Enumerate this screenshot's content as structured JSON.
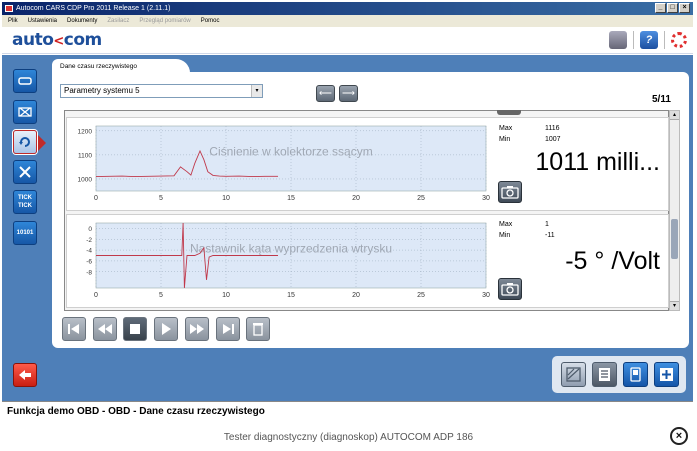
{
  "window": {
    "title": "Autocom CARS CDP Pro   2011 Release 1 (2.11.1)",
    "controls": [
      "_",
      "□",
      "×"
    ]
  },
  "menu": {
    "items": [
      {
        "label": "Plik",
        "enabled": true
      },
      {
        "label": "Ustawienia",
        "enabled": true
      },
      {
        "label": "Dokumenty",
        "enabled": true
      },
      {
        "label": "Zasilacz",
        "enabled": false
      },
      {
        "label": "Przegląd pomiarów",
        "enabled": false
      },
      {
        "label": "Pomoc",
        "enabled": true
      }
    ]
  },
  "header": {
    "logo_left": "auto",
    "logo_sep": "<",
    "logo_right": "com"
  },
  "tab": {
    "label": "Dane czasu rzeczywistego"
  },
  "system_select": {
    "value": "Parametry systemu 5"
  },
  "page_indicator": "5/11",
  "charts": [
    {
      "title": "Ciśnienie w kolektorze ssącym",
      "max_label": "Max",
      "max_value": "1116",
      "min_label": "Min",
      "min_value": "1007",
      "current": "1011 milli...",
      "yticks": [
        "1200",
        "1100",
        "1000"
      ],
      "xticks": [
        "0",
        "5",
        "10",
        "15",
        "20",
        "25",
        "30"
      ]
    },
    {
      "title": "Nastawnik kąta wyprzedzenia wtrysku",
      "max_label": "Max",
      "max_value": "1",
      "min_label": "Min",
      "min_value": "-11",
      "current": "-5 ° /Volt",
      "yticks": [
        "0",
        "-2",
        "-4",
        "-6",
        "-8"
      ],
      "xticks": [
        "0",
        "5",
        "10",
        "15",
        "20",
        "25",
        "30"
      ]
    }
  ],
  "chart_data": [
    {
      "type": "line",
      "title": "Ciśnienie w kolektorze ssącym",
      "xlim": [
        0,
        30
      ],
      "ylim": [
        950,
        1220
      ],
      "x": [
        0,
        1,
        2,
        3,
        4,
        5,
        6,
        6.5,
        7,
        7.3,
        7.6,
        8,
        8.3,
        8.6,
        9,
        9.5,
        10,
        11,
        12,
        13,
        14
      ],
      "y": [
        1010,
        1011,
        1012,
        1010,
        1011,
        1012,
        1013,
        1050,
        1030,
        1016,
        1065,
        1116,
        1080,
        1030,
        1015,
        1012,
        1011,
        1012,
        1010,
        1011,
        1011
      ]
    },
    {
      "type": "line",
      "title": "Nastawnik kąta wyprzedzenia wtrysku",
      "xlim": [
        0,
        30
      ],
      "ylim": [
        -11,
        1
      ],
      "x": [
        0,
        1,
        2,
        3,
        4,
        5,
        6,
        6.6,
        6.7,
        6.8,
        7.0,
        7.2,
        7.6,
        8.0,
        8.3,
        8.5,
        8.7,
        9.0,
        10,
        11,
        12,
        13,
        14
      ],
      "y": [
        -5,
        -5,
        -5,
        -5,
        -5,
        -5,
        -5,
        -5,
        1,
        -11,
        -5,
        -5,
        -5,
        -4.6,
        -3.6,
        -9.5,
        -5.3,
        -5,
        -5,
        -5,
        -5,
        -5,
        -5
      ]
    }
  ],
  "status": {
    "text": "Funkcja demo OBD - OBD - Dane czasu rzeczywistego"
  },
  "caption": {
    "text": "Tester diagnostyczny (diagnoskop) AUTOCOM ADP 186"
  },
  "left_toolbar": {
    "tick_label_1": "TICK",
    "tick_label_2": "TICK",
    "shape_label": "10101"
  },
  "colors": {
    "accent_blue": "#4e7fb8",
    "plot_bg": "#dde8f7",
    "trace": "#c0394b",
    "brand_red": "#d02020"
  }
}
